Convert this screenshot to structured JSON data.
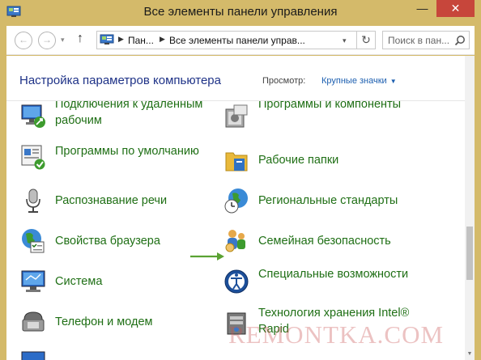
{
  "window": {
    "title": "Все элементы панели управления",
    "minimize_glyph": "—",
    "close_glyph": "✕",
    "frame_color": "#d4ba6a",
    "close_color": "#c7463b"
  },
  "nav": {
    "back_glyph": "←",
    "forward_glyph": "→",
    "recent_glyph": "▾",
    "up_glyph": "↑",
    "breadcrumb_1": "Пан...",
    "breadcrumb_2": "Все элементы панели управ...",
    "breadcrumb_separator": "▶",
    "address_drop_glyph": "▾",
    "refresh_glyph": "↻",
    "search_placeholder": "Поиск в пан..."
  },
  "header": {
    "title": "Настройка параметров компьютера",
    "view_label": "Просмотр:",
    "view_value": "Крупные значки",
    "view_caret": "▼"
  },
  "items": {
    "remote": {
      "label": "Подключения к удаленным рабочим",
      "icon": "remote-desktop-icon"
    },
    "programs": {
      "label": "Программы и компоненты",
      "icon": "programs-features-icon"
    },
    "defaults": {
      "label": "Программы по умолчанию",
      "icon": "default-programs-icon"
    },
    "work_folders": {
      "label": "Рабочие папки",
      "icon": "work-folders-icon"
    },
    "speech": {
      "label": "Распознавание речи",
      "icon": "microphone-icon"
    },
    "region": {
      "label": "Региональные стандарты",
      "icon": "region-clock-icon"
    },
    "browser": {
      "label": "Свойства браузера",
      "icon": "internet-options-icon"
    },
    "family": {
      "label": "Семейная безопасность",
      "icon": "family-safety-icon"
    },
    "system": {
      "label": "Система",
      "icon": "system-icon"
    },
    "access": {
      "label": "Специальные возможности",
      "icon": "ease-of-access-icon"
    },
    "phone": {
      "label": "Телефон и модем",
      "icon": "phone-modem-icon"
    },
    "storage": {
      "label": "Технология хранения Intel® Rapid",
      "icon": "intel-storage-icon"
    }
  },
  "scroll_down_glyph": "▼",
  "watermark": "REMONTKA.COM",
  "colors": {
    "link_green": "#1f6f15",
    "title_blue": "#1e3287",
    "view_blue": "#1c5fb0",
    "arrow_green": "#5aa233"
  }
}
